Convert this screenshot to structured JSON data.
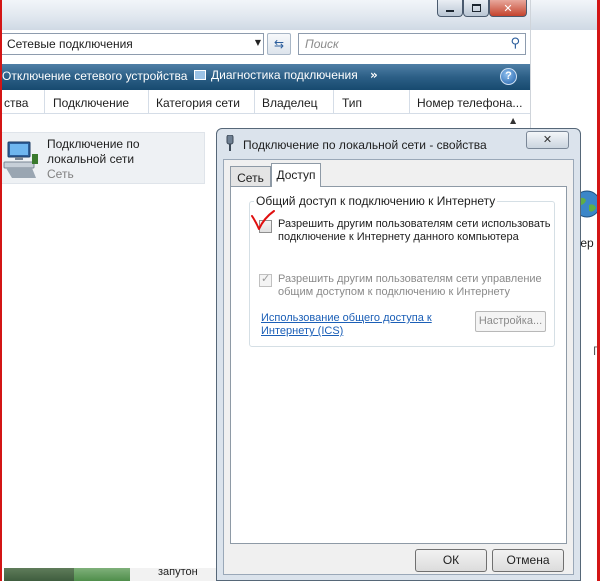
{
  "explorer": {
    "address": "Сетевые подключения",
    "search_placeholder": "Поиск",
    "toolbar": {
      "disconnect": "Отключение сетевого устройства",
      "diagnose": "Диагностика подключения",
      "more": "»",
      "help": "?"
    },
    "columns": [
      "ства",
      "Подключение",
      "Категория сети",
      "Владелец",
      "Тип",
      "Номер телефона..."
    ],
    "item": {
      "name": "Подключение по локальной сети",
      "subtitle": "Сеть"
    },
    "bottom_text": "запутон"
  },
  "right_window": {
    "link_fragment": "с",
    "globe_label": "тер",
    "fragment_p": "Г"
  },
  "dialog": {
    "title": "Подключение по локальной сети - свойства",
    "close_glyph": "✕",
    "tabs": [
      "Сеть",
      "Доступ"
    ],
    "active_tab": "Доступ",
    "group_title": "Общий доступ к подключению к Интернету",
    "option1": {
      "label": "Разрешить другим пользователям сети использовать подключение к Интернету данного компьютера",
      "checked": true,
      "annotation_color": "#e01010"
    },
    "option2": {
      "label": "Разрешить другим пользователям сети управление общим доступом к подключению к Интернету",
      "checked": true,
      "enabled": false
    },
    "ics_link": "Использование общего доступа к Интернету (ICS)",
    "settings_button": "Настройка...",
    "ok_button": "ОК",
    "cancel_button": "Отмена"
  },
  "colors": {
    "toolbar": "#2c5f86",
    "link": "#1b5fb7",
    "frame": "#d31515"
  }
}
